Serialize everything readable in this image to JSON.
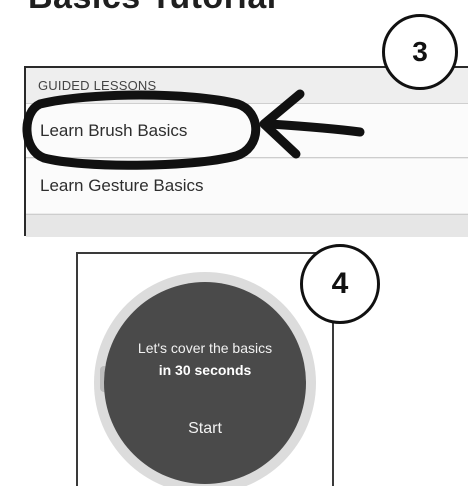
{
  "heading": {
    "title": "Basics Tutorial"
  },
  "steps": {
    "three": "3",
    "four": "4"
  },
  "lessons": {
    "header": "GUIDED LESSONS",
    "items": [
      {
        "label": "Learn Brush Basics"
      },
      {
        "label": "Learn Gesture Basics"
      }
    ]
  },
  "start_screen": {
    "line1": "Let's cover the basics",
    "line2": "in 30 seconds",
    "button": "Start"
  },
  "colors": {
    "panel_bg": "#ececec",
    "item_bg": "#fbfbfb",
    "circle_dark": "#4a4a4a",
    "ring": "#dcdcdc",
    "annotation": "#111111"
  }
}
